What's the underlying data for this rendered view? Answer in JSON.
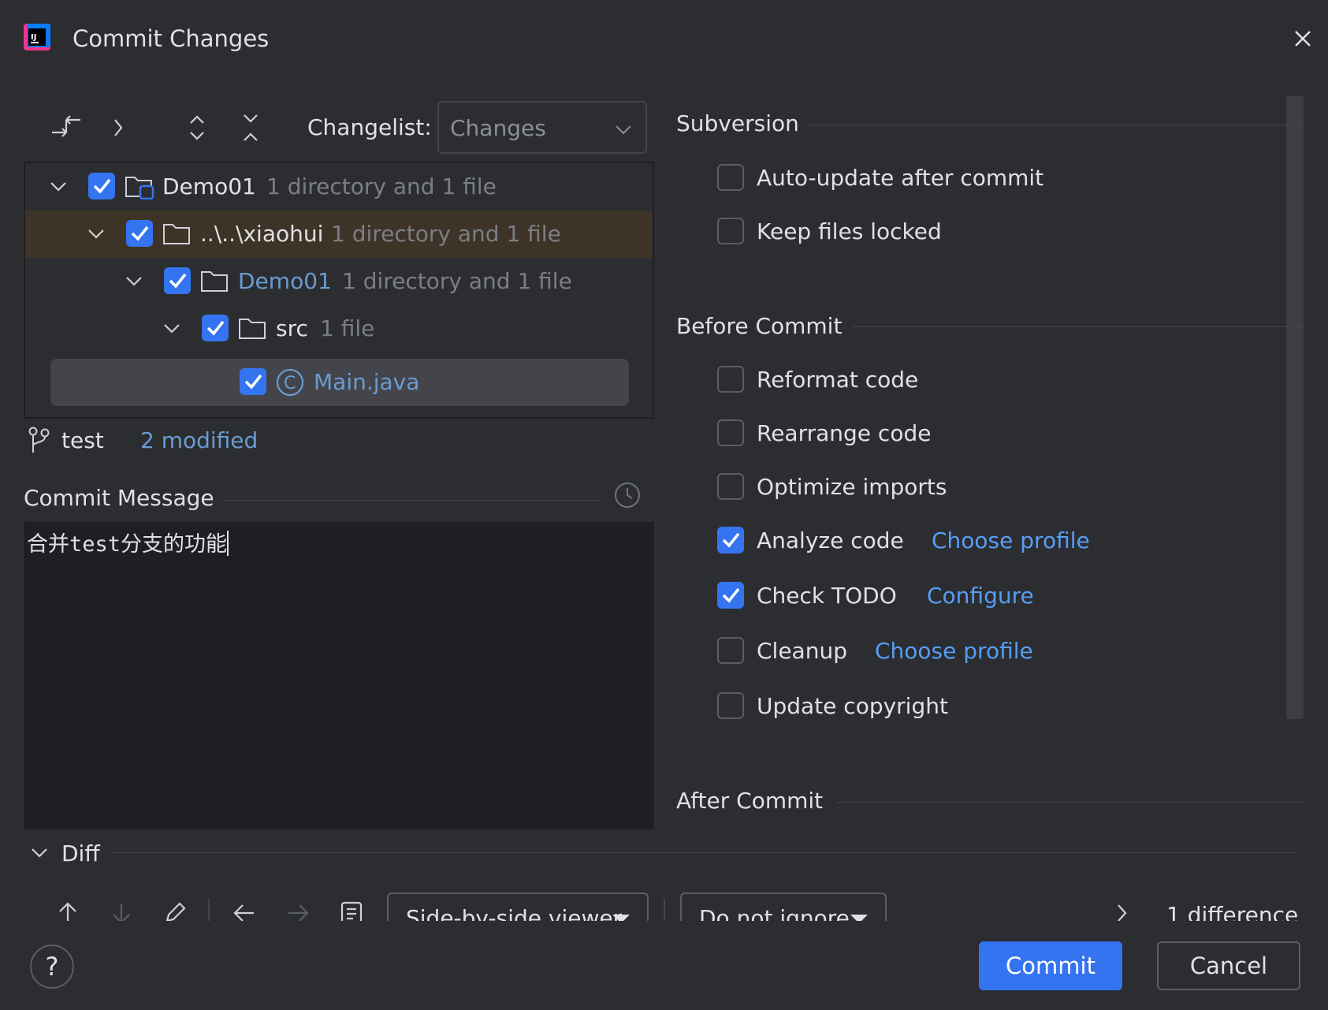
{
  "window": {
    "title": "Commit Changes"
  },
  "toolbar": {
    "changelist_label": "Changelist:",
    "changelist_value": "Changes"
  },
  "tree": {
    "rows": [
      {
        "name": "Demo01",
        "info": "1 directory and 1 file",
        "checked": true
      },
      {
        "name": "..\\..\\xiaohui",
        "info": "1 directory and 1 file",
        "checked": true
      },
      {
        "name": "Demo01",
        "info": "1 directory and 1 file",
        "checked": true
      },
      {
        "name": "src",
        "info": "1 file",
        "checked": true
      },
      {
        "name": "Main.java",
        "info": "",
        "checked": true
      }
    ]
  },
  "branch": {
    "name": "test",
    "modified": "2 modified"
  },
  "commit_message": {
    "label": "Commit Message",
    "text": "合并test分支的功能"
  },
  "subversion": {
    "title": "Subversion",
    "options": [
      {
        "label": "Auto-update after commit",
        "checked": false
      },
      {
        "label": "Keep files locked",
        "checked": false
      }
    ]
  },
  "before_commit": {
    "title": "Before Commit",
    "options": [
      {
        "label": "Reformat code",
        "checked": false,
        "link": ""
      },
      {
        "label": "Rearrange code",
        "checked": false,
        "link": ""
      },
      {
        "label": "Optimize imports",
        "checked": false,
        "link": ""
      },
      {
        "label": "Analyze code",
        "checked": true,
        "link": "Choose profile"
      },
      {
        "label": "Check TODO",
        "checked": true,
        "link": "Configure"
      },
      {
        "label": "Cleanup",
        "checked": false,
        "link": "Choose profile"
      },
      {
        "label": "Update copyright",
        "checked": false,
        "link": ""
      }
    ]
  },
  "after_commit": {
    "title": "After Commit"
  },
  "diff": {
    "label": "Diff",
    "viewer": "Side-by-side viewer",
    "ignore": "Do not ignore",
    "count": "1 difference"
  },
  "buttons": {
    "help": "?",
    "commit": "Commit",
    "cancel": "Cancel"
  },
  "colors": {
    "accent": "#3574f0",
    "link": "#589df6",
    "background": "#2b2d30",
    "editor": "#1e1f22"
  },
  "icons": [
    "intellij-logo-icon",
    "close-icon",
    "show-diff-icon",
    "expand-icon",
    "expand-all-icon",
    "collapse-all-icon",
    "folder-icon",
    "module-folder-icon",
    "java-class-icon",
    "branch-icon",
    "clock-icon",
    "arrow-up-icon",
    "arrow-down-icon",
    "edit-icon",
    "arrow-left-icon",
    "arrow-right-icon",
    "document-icon",
    "chevron-right-icon",
    "help-icon"
  ]
}
